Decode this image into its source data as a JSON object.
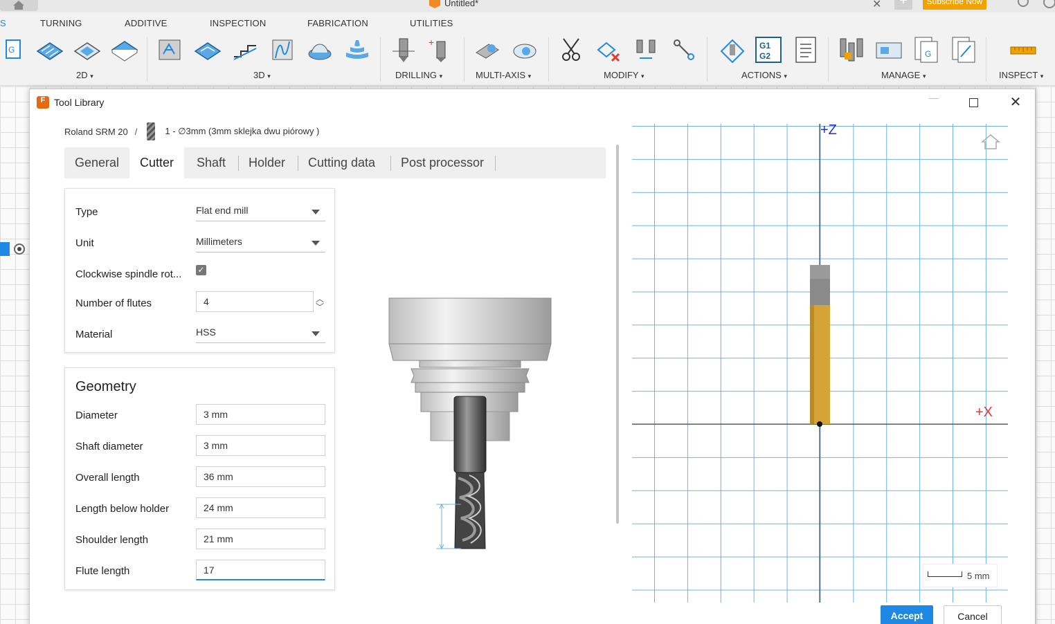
{
  "app": {
    "doc_title": "Untitled*",
    "subscribe_label": "Subscribe Now",
    "tabs": [
      "S",
      "TURNING",
      "ADDITIVE",
      "INSPECTION",
      "FABRICATION",
      "UTILITIES"
    ],
    "groups": [
      "2D",
      "3D",
      "DRILLING",
      "MULTI-AXIS",
      "MODIFY",
      "ACTIONS",
      "MANAGE",
      "INSPECT"
    ],
    "group_carets": [
      "▾",
      "▾",
      "▾",
      "▾",
      "▾",
      "▾",
      "▾",
      "▾"
    ]
  },
  "dialog": {
    "title": "Tool Library",
    "app_icon_letter": "F",
    "breadcrumb": {
      "library": "Roland SRM 20",
      "separator": "/",
      "tool": "1 - ∅3mm (3mm sklejka dwu piórowy )"
    },
    "tabs": [
      "General",
      "Cutter",
      "Shaft",
      "Holder",
      "Cutting data",
      "Post processor"
    ],
    "active_tab": "Cutter",
    "cutter": {
      "type_label": "Type",
      "type_value": "Flat end mill",
      "unit_label": "Unit",
      "unit_value": "Millimeters",
      "clockwise_label": "Clockwise spindle rot...",
      "clockwise_checked": true,
      "flutes_label": "Number of flutes",
      "flutes_value": "4",
      "material_label": "Material",
      "material_value": "HSS"
    },
    "geometry": {
      "title": "Geometry",
      "fields": [
        {
          "label": "Diameter",
          "value": "3 mm"
        },
        {
          "label": "Shaft diameter",
          "value": "3 mm"
        },
        {
          "label": "Overall length",
          "value": "36 mm"
        },
        {
          "label": "Length below holder",
          "value": "24 mm"
        },
        {
          "label": "Shoulder length",
          "value": "21 mm"
        },
        {
          "label": "Flute length",
          "value": "17"
        }
      ]
    },
    "viewport": {
      "z_label": "+Z",
      "x_label": "+X",
      "scale_label": "5 mm",
      "tool_color": "#d4a536",
      "holder_color": "#8a8a8a",
      "grid_color": "#6bb4df"
    },
    "buttons": {
      "accept": "Accept",
      "cancel": "Cancel"
    },
    "window_controls": {
      "minimize": "—",
      "close": "✕"
    }
  }
}
